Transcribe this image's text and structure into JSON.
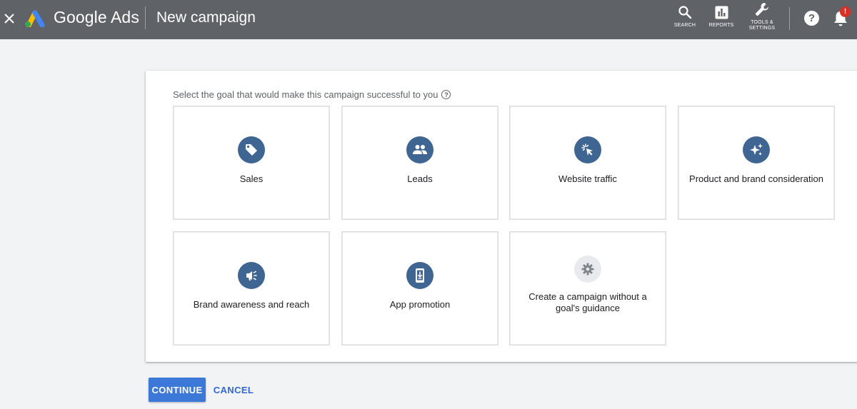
{
  "header": {
    "brand": "Google Ads",
    "title": "New campaign",
    "tools": {
      "search_label": "SEARCH",
      "reports_label": "REPORTS",
      "tools_label_line1": "TOOLS &",
      "tools_label_line2": "SETTINGS"
    },
    "help_glyph": "?",
    "notification_badge": "!",
    "bar_color": "#5f6368"
  },
  "main": {
    "prompt": "Select the goal that would make this campaign successful to you",
    "prompt_help_glyph": "?",
    "goals": [
      {
        "label": "Sales",
        "icon": "tag-icon"
      },
      {
        "label": "Leads",
        "icon": "people-icon"
      },
      {
        "label": "Website traffic",
        "icon": "cursor-click-icon"
      },
      {
        "label": "Product and brand consideration",
        "icon": "sparkle-icon"
      },
      {
        "label": "Brand awareness and reach",
        "icon": "megaphone-icon"
      },
      {
        "label": "App promotion",
        "icon": "phone-download-icon"
      },
      {
        "label": "Create a campaign without a goal's guidance",
        "icon": "gear-icon"
      }
    ],
    "icon_color": "#3f6592"
  },
  "actions": {
    "continue_label": "CONTINUE",
    "cancel_label": "CANCEL",
    "continue_color": "#3c78d8",
    "cancel_color": "#3367d6"
  }
}
